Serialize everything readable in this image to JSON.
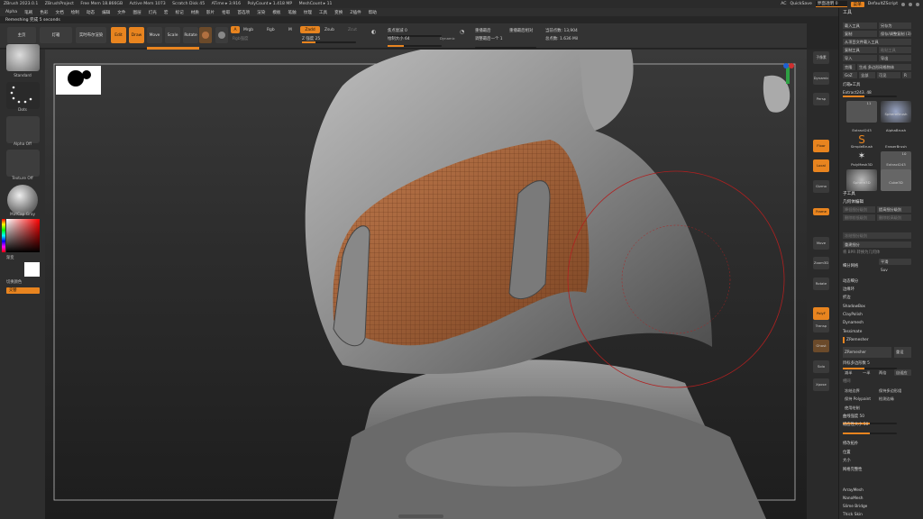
{
  "titlebar": {
    "items": [
      "ZBrush 2023.0.1",
      "ZBrushProject",
      "Free Mem 18.866GB",
      "Active Mem 1073",
      "Scratch Disk 45",
      "ATime ▸ 3.916",
      "PolyCount ▸ 1.418 MP",
      "MeshCount ▸ 11"
    ],
    "right": {
      "ac": "AC",
      "quicksave": "QuickSave",
      "transparency": "界面透明 0",
      "menu": "菜单",
      "script": "DefaultZScript"
    }
  },
  "menubar": {
    "items": [
      "Alpha",
      "笔刷",
      "色彩",
      "文档",
      "绘制",
      "动态",
      "编辑",
      "文件",
      "图层",
      "灯光",
      "宏",
      "标记",
      "材质",
      "影片",
      "拾取",
      "首选项",
      "渲染",
      "模板",
      "笔触",
      "纹理",
      "工具",
      "变换",
      "Z插件",
      "帮助"
    ]
  },
  "notice": "Remeshing 完成 5 seconds",
  "toolbar": {
    "home": "主页",
    "lightbox": "灯箱",
    "liverender": "实时布尔渲染",
    "edit": "Edit",
    "draw": "Draw",
    "move": "Move",
    "scale": "Scale",
    "rotate": "Rotate",
    "a_label": "A",
    "mrgb": "Mrgb",
    "rgb": "Rgb",
    "m": "M",
    "zadd": "Zadd",
    "zsub": "Zsub",
    "zcut": "Zcut",
    "rgb_strength": "Rgb强度",
    "z_intensity": "Z 强度 25",
    "z_intensity_value": 0.25,
    "focal_shift": "焦点衰减 0",
    "draw_size": "绘制大小 64",
    "draw_size_value": 0.3,
    "dynamic": "Dynamic",
    "active_points": "当前点数: 13,904",
    "total_points": "总点数: 1.636 Mil",
    "replay_last": "重播最后",
    "replay_rel": "重播最后相对",
    "adjust_last": "调整最后一个 1"
  },
  "left_shelf": {
    "brush": "Standard",
    "stroke": "Dots",
    "alpha": "Alpha Off",
    "texture": "Texture Off",
    "material": "MatCap Gray",
    "gradient": "渐变",
    "switch_color": "切换颜色",
    "alternate": "交替"
  },
  "right_shelf": {
    "items": [
      "子像素",
      "Dynamic",
      "Persp",
      "Floor",
      "Local",
      "Gizmo",
      "Frame",
      "Move",
      "Zoom3D",
      "Rotate",
      "PolyF",
      "Transp",
      "Ghost",
      "Solo",
      "Xpose"
    ]
  },
  "tray": {
    "title": "工具",
    "load_tool": "载入工具",
    "save_as": "另存为",
    "copy": "复制",
    "paste": "保存/调整复制 (3)",
    "import_from_project": "从项目文件载入工具",
    "copy_tool": "复制工具",
    "paste_tool": "粘贴工具",
    "import": "导入",
    "export": "导出",
    "clone": "克隆",
    "make_polymesh": "生成 多边形网格物体",
    "goz": "GoZ",
    "all": "全部",
    "visible": "可见",
    "r": "R",
    "lightbox_tools": "灯箱▸工具",
    "extract_label": "Extract243. 48",
    "tools": [
      {
        "name": "Extract243",
        "count": "11"
      },
      {
        "name": "SphereBrush",
        "count": ""
      },
      {
        "name": "AlphaBrush",
        "count": ""
      },
      {
        "name": "SimpleBrush",
        "count": ""
      },
      {
        "name": "EraserBrush",
        "count": ""
      },
      {
        "name": "PolyMesh3D",
        "count": ""
      },
      {
        "name": "Extract243",
        "count": "10"
      },
      {
        "name": "Sphere3D",
        "count": ""
      },
      {
        "name": "Cube3D",
        "count": ""
      }
    ],
    "subtool": "子工具",
    "geometry": "几何体编辑",
    "lower_res": "降低细分级别",
    "higher_res": "提高细分级别",
    "del_lower": "删除较低级别",
    "del_higher": "删除较高级别",
    "freeze": "冻结细分级别",
    "reconstruct": "重建细分",
    "convert_bpr": "将 BPR 转换为几何体",
    "divide": "细分网格",
    "smt": "平滑",
    "suv": "Suv",
    "edge_loop": "边缘环",
    "crease": "折边",
    "shadowbox": "ShadowBox",
    "claypolish": "ClayPolish",
    "dynamesh": "Dynamesh",
    "tessimate": "Tessimate",
    "zremesher": "ZRemesher",
    "zremesher_btn": "ZRemesher",
    "legacy": "重设",
    "target_poly": "目标多边形数 5",
    "target_poly_value": 0.4,
    "half": "一半",
    "same": "相同",
    "double": "两倍",
    "adapt": "自适应",
    "freeze_border": "冻结边界",
    "keep_groups": "保持多边形组",
    "keep_polypaint": "保持 Polypaint",
    "detect_edges": "检测边缘",
    "use_polypaint": "使用绘制",
    "curves_strength": "曲线强度 50",
    "curves_strength_value": 0.5,
    "adaptive_size": "适应性大小 50",
    "adaptive_size_value": 0.5,
    "modify_topology": "修改拓扑",
    "position": "位置",
    "size": "大小",
    "mesh_integrity": "网格完整性",
    "arraymesh": "ArrayMesh",
    "nanomesh": "NanoMesh",
    "slime_bridge": "Slime Bridge",
    "thick_skin": "Thick Skin"
  },
  "colors": {
    "accent": "#e8841f",
    "panel": "#2c2c2c",
    "bg": "#262626"
  }
}
